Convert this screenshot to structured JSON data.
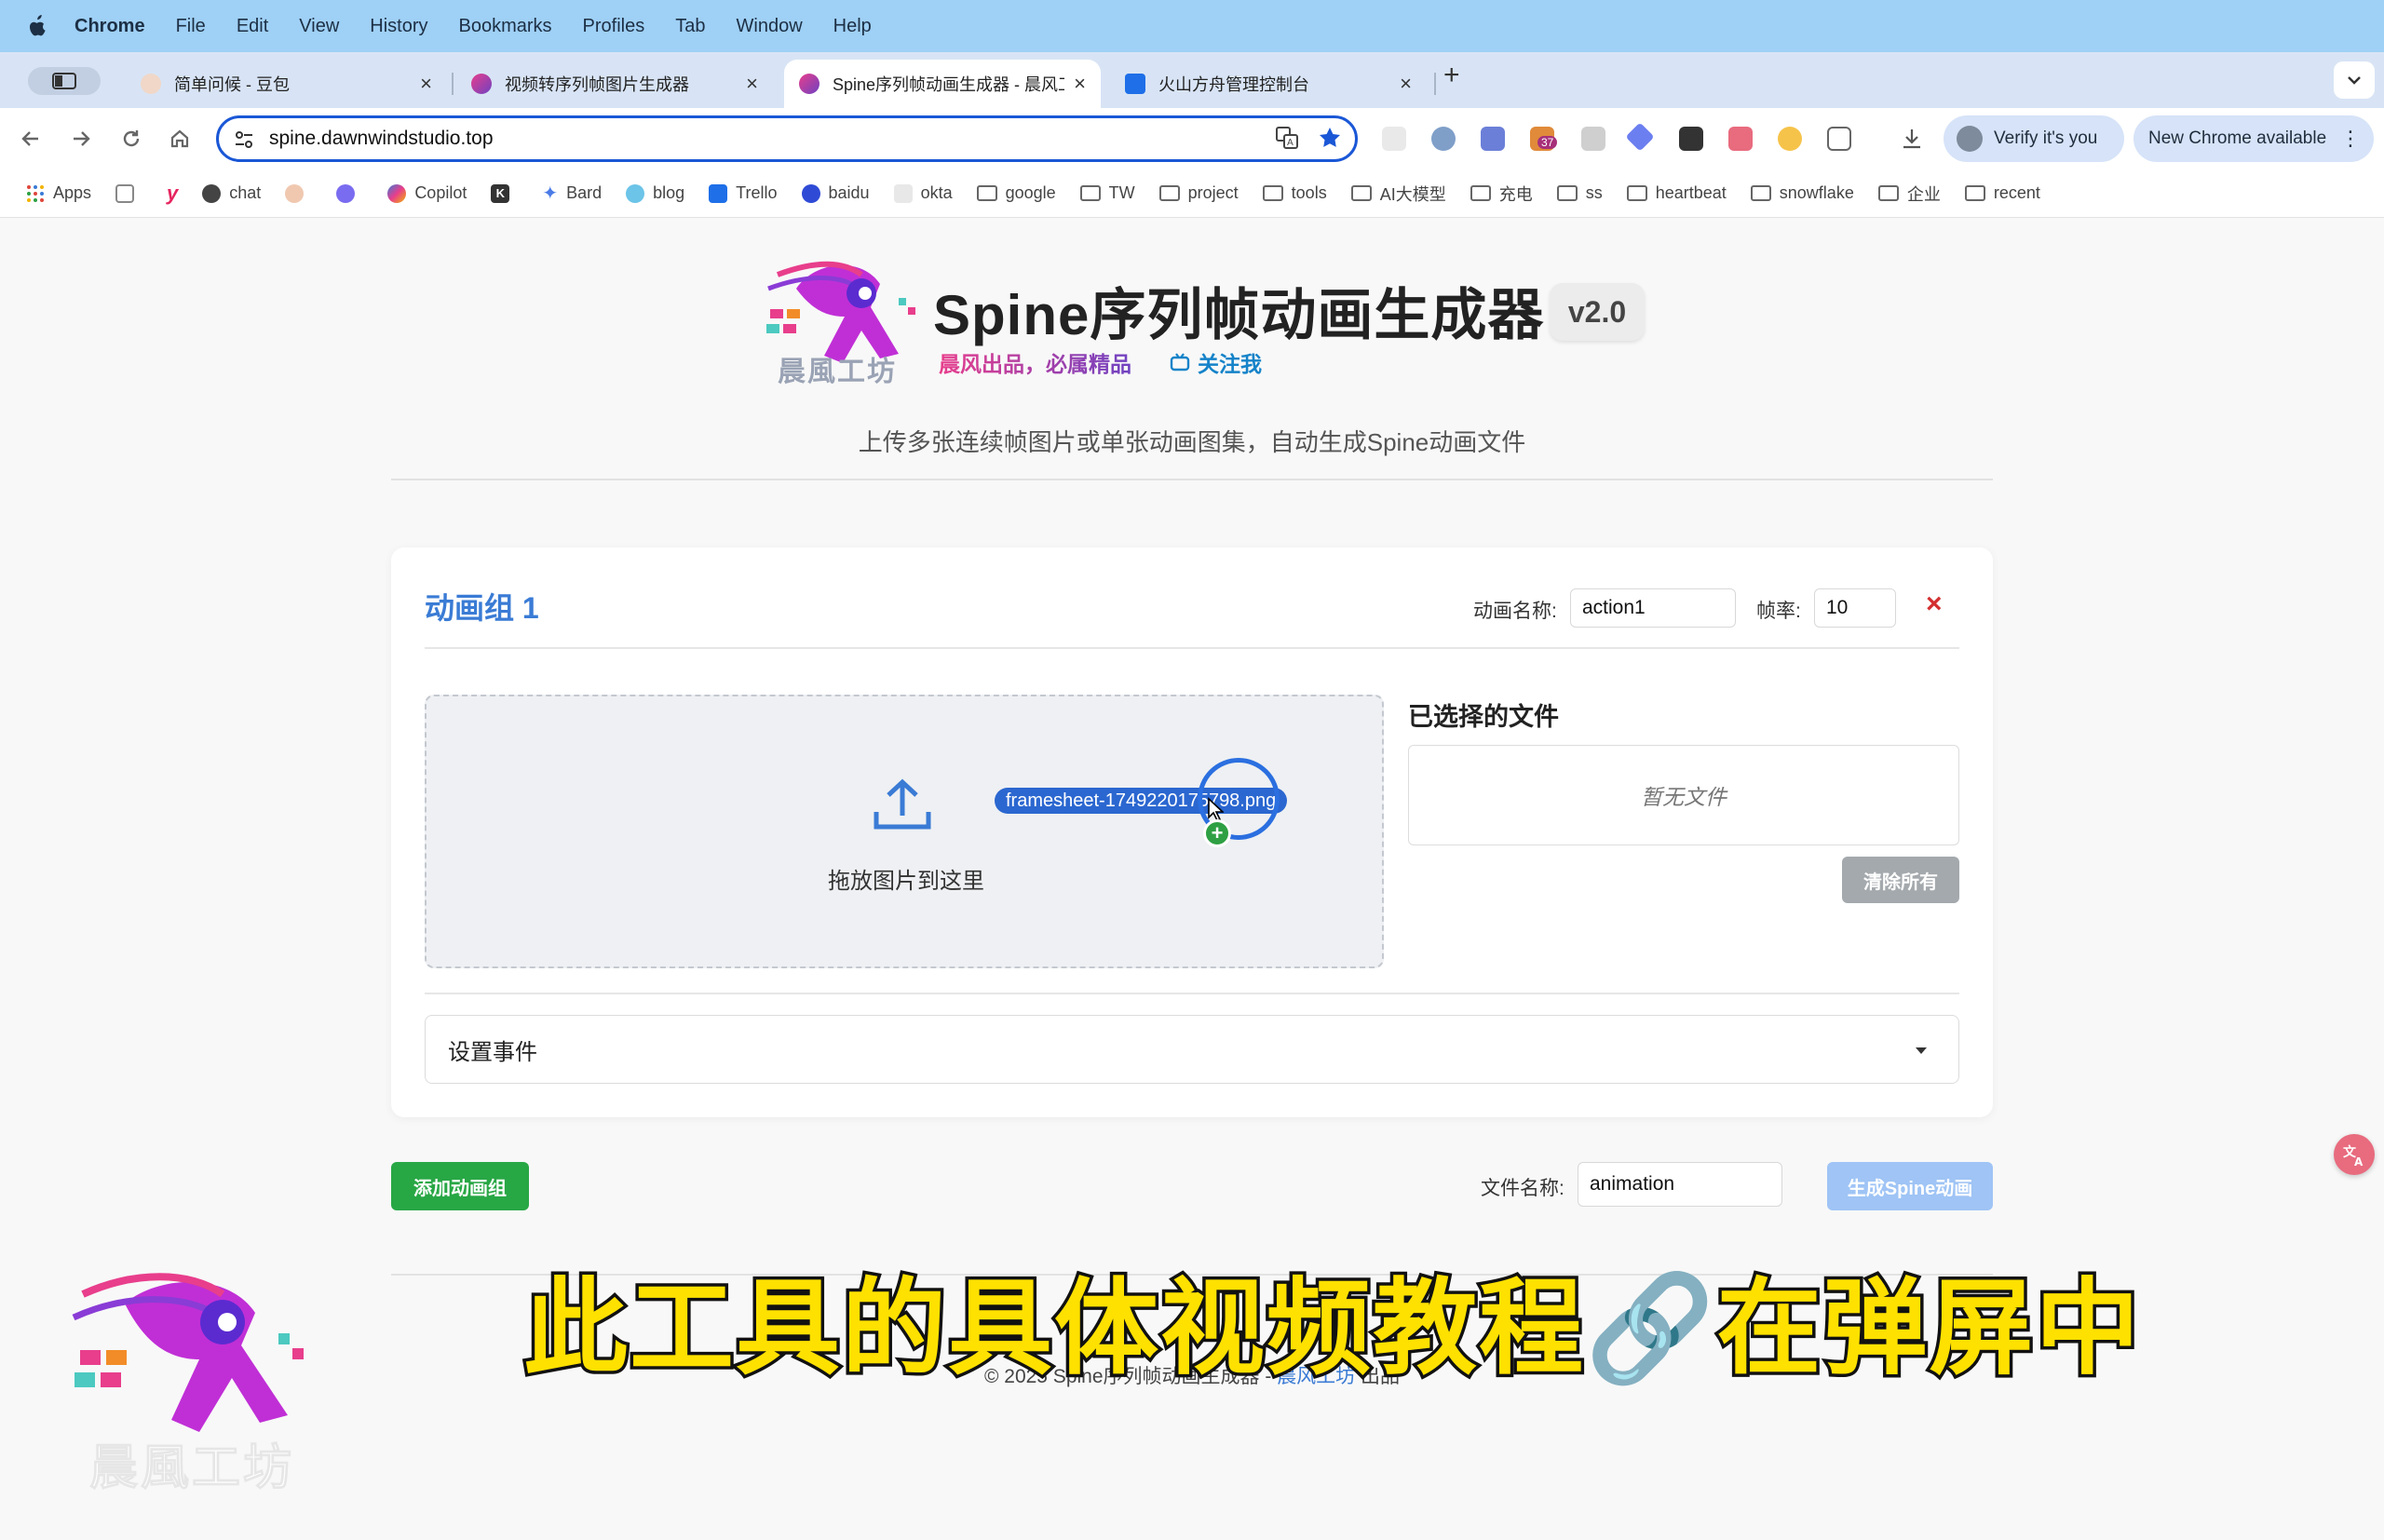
{
  "menubar": {
    "app": "Chrome",
    "items": [
      "File",
      "Edit",
      "View",
      "History",
      "Bookmarks",
      "Profiles",
      "Tab",
      "Window",
      "Help"
    ]
  },
  "tabs": [
    {
      "title": "简单问候 - 豆包",
      "active": false
    },
    {
      "title": "视频转序列帧图片生成器",
      "active": false
    },
    {
      "title": "Spine序列帧动画生成器 - 晨风工",
      "active": true
    },
    {
      "title": "火山方舟管理控制台",
      "active": false
    }
  ],
  "toolbar": {
    "url": "spine.dawnwindstudio.top",
    "verify_label": "Verify it's you",
    "new_chrome_label": "New Chrome available",
    "extension_badge": "37"
  },
  "bookmarks": [
    {
      "label": "Apps",
      "type": "apps"
    },
    {
      "label": "",
      "type": "grid"
    },
    {
      "label": "",
      "type": "y"
    },
    {
      "label": "chat",
      "type": "site"
    },
    {
      "label": "",
      "type": "avatar"
    },
    {
      "label": "",
      "type": "site2"
    },
    {
      "label": "Copilot",
      "type": "site"
    },
    {
      "label": "",
      "type": "k"
    },
    {
      "label": "Bard",
      "type": "site"
    },
    {
      "label": "blog",
      "type": "site"
    },
    {
      "label": "Trello",
      "type": "site"
    },
    {
      "label": "baidu",
      "type": "site"
    },
    {
      "label": "okta",
      "type": "site"
    },
    {
      "label": "google",
      "type": "folder"
    },
    {
      "label": "TW",
      "type": "folder"
    },
    {
      "label": "project",
      "type": "folder"
    },
    {
      "label": "tools",
      "type": "folder"
    },
    {
      "label": "AI大模型",
      "type": "folder"
    },
    {
      "label": "充电",
      "type": "folder"
    },
    {
      "label": "ss",
      "type": "folder"
    },
    {
      "label": "heartbeat",
      "type": "folder"
    },
    {
      "label": "snowflake",
      "type": "folder"
    },
    {
      "label": "企业",
      "type": "folder"
    },
    {
      "label": "recent",
      "type": "folder"
    }
  ],
  "header": {
    "logo_text": "晨風工坊",
    "title": "Spine序列帧动画生成器",
    "version": "v2.0",
    "slogan": "晨风出品，必属精品",
    "follow": "关注我",
    "subtitle": "上传多张连续帧图片或单张动画图集，自动生成Spine动画文件"
  },
  "group": {
    "title": "动画组 1",
    "name_label": "动画名称:",
    "name_value": "action1",
    "fps_label": "帧率:",
    "fps_value": "10",
    "delete_icon": "×",
    "drop_text": "拖放图片到这里",
    "dragging_file": "framesheet-1749220175798.png",
    "selected_title": "已选择的文件",
    "empty_text": "暂无文件",
    "clear_label": "清除所有",
    "events_label": "设置事件"
  },
  "actions": {
    "add_group": "添加动画组",
    "filename_label": "文件名称:",
    "filename_value": "animation",
    "generate": "生成Spine动画"
  },
  "footer": {
    "prefix": "© 2025 Spine序列帧动画生成器 - ",
    "studio": "晨风工坊",
    "suffix": " 出品"
  },
  "overlay": {
    "caption": "此工具的具体视频教程🔗在弹屏中",
    "watermark_text": "晨風工坊"
  },
  "colors": {
    "accent": "#3a7bd5",
    "danger": "#d32f2f",
    "success": "#28a745",
    "generate_disabled": "#9fc4f5",
    "caption_fill": "#ffe100"
  }
}
